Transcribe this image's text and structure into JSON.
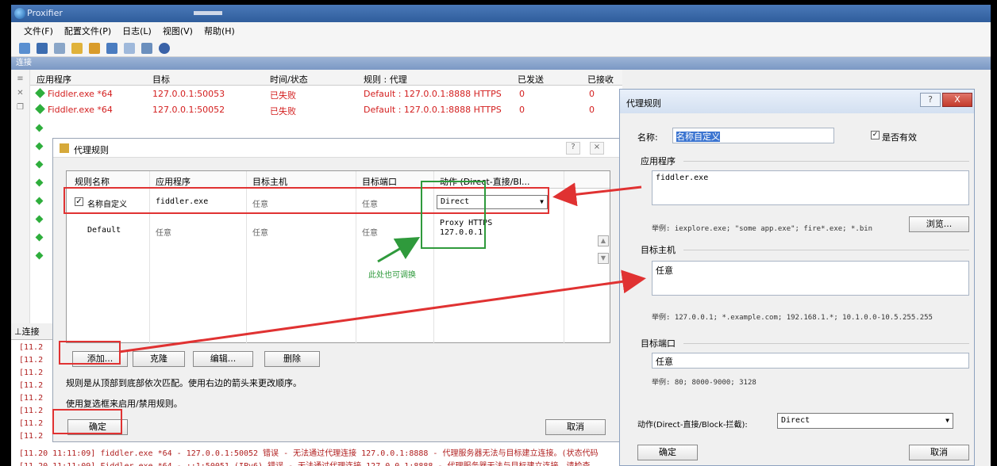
{
  "window": {
    "title": "Proxifier"
  },
  "menu": [
    "文件(F)",
    "配置文件(P)",
    "日志(L)",
    "视图(V)",
    "帮助(H)"
  ],
  "section_label": "连接",
  "connections": {
    "headers": [
      "应用程序",
      "目标",
      "时间/状态",
      "规则 : 代理",
      "已发送",
      "已接收"
    ],
    "rows": [
      {
        "app": "Fiddler.exe *64",
        "target": "127.0.0.1:50053",
        "status": "已失败",
        "rule": "Default : 127.0.0.1:8888 HTTPS",
        "sent": "0",
        "received": "0"
      },
      {
        "app": "Fiddler.exe *64",
        "target": "127.0.0.1:50052",
        "status": "已失败",
        "rule": "Default : 127.0.0.1:8888 HTTPS",
        "sent": "0",
        "received": "0"
      }
    ]
  },
  "log": {
    "tab": "连接",
    "prefixes": [
      "[11.2",
      "[11.2",
      "[11.2",
      "[11.2",
      "[11.2",
      "[11.2",
      "[11.2",
      "[11.2"
    ],
    "line1": "[11.20 11:11:09] fiddler.exe *64 - 127.0.0.1:50052 错误 - 无法通过代理连接 127.0.0.1:8888 - 代理服务器无法与目标建立连接。(状态代码",
    "line2": "[11.20 11:11:09] Fiddler.exe *64 - ::1:50051 (IPv6) 错误 - 无法通过代理连接 127.0.0.1:8888 - 代理服务器无法与目标建立连接，请检查"
  },
  "rules_dialog": {
    "title": "代理规则",
    "min_btn": "?",
    "close_btn": "×",
    "headers": [
      "规则名称",
      "应用程序",
      "目标主机",
      "目标端口",
      "动作 (Direct-直接/Bl..."
    ],
    "rows": [
      {
        "checked": "✓",
        "name": "名称自定义",
        "app": "fiddler.exe",
        "host": "任意",
        "port": "任意",
        "action": "Direct"
      },
      {
        "name": "Default",
        "app": "任意",
        "host": "任意",
        "port": "任意",
        "action": "Proxy HTTPS\n127.0.0.1"
      }
    ],
    "annotation": "此处也可调换",
    "buttons": {
      "add": "添加...",
      "clone": "克隆",
      "edit": "编辑...",
      "delete": "删除"
    },
    "help1": "规则是从顶部到底部依次匹配。使用右边的箭头来更改顺序。",
    "help2": "使用复选框来启用/禁用规则。",
    "ok": "确定",
    "cancel": "取消"
  },
  "edit_dialog": {
    "title": "代理规则",
    "help_btn": "?",
    "close_btn": "X",
    "name_label": "名称:",
    "name_value": "名称自定义",
    "enabled_label": "是否有效",
    "enabled_check": "✓",
    "app_group": "应用程序",
    "app_value": "fiddler.exe",
    "app_hint": "举例: iexplore.exe; \"some app.exe\"; fire*.exe; *.bin",
    "browse_btn": "浏览...",
    "host_group": "目标主机",
    "host_value": "任意",
    "host_hint": "举例: 127.0.0.1; *.example.com; 192.168.1.*; 10.1.0.0-10.5.255.255",
    "port_group": "目标端口",
    "port_value": "任意",
    "port_hint": "举例: 80; 8000-9000; 3128",
    "action_label": "动作(Direct-直接/Block-拦截):",
    "action_value": "Direct",
    "ok": "确定",
    "cancel": "取消"
  },
  "colors": {
    "highlight_red": "#e03232",
    "highlight_green": "#2f9a3c",
    "failed_text": "#d31e1e"
  }
}
